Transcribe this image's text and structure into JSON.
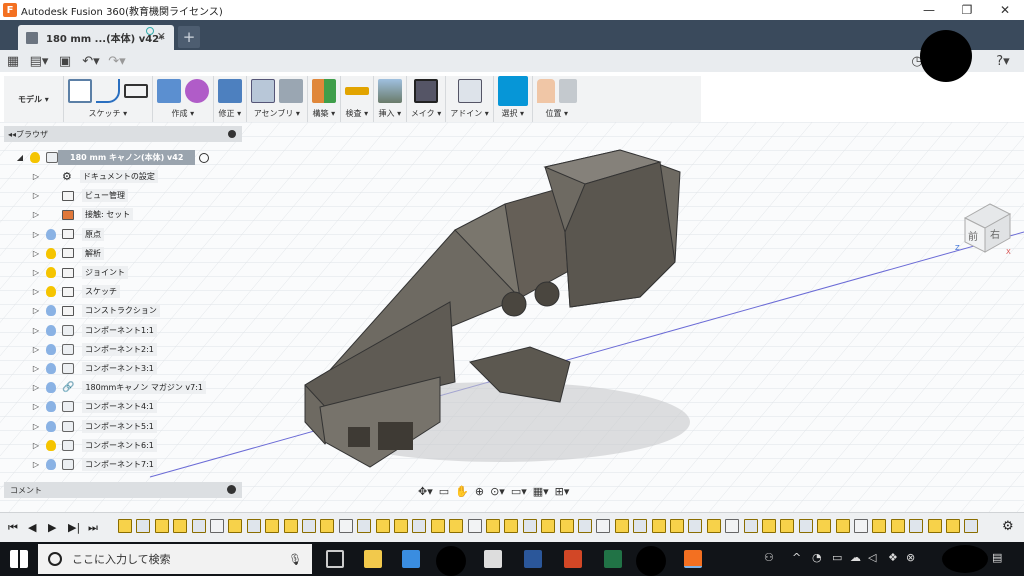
{
  "window": {
    "title": "Autodesk Fusion 360(教育機関ライセンス)",
    "logo": "F"
  },
  "tab": {
    "title": "180 mm ...(本体) v42*"
  },
  "toolbar": {
    "mode": "モデル ▾",
    "groups": [
      {
        "label": "スケッチ ▾",
        "icons": [
          "create-sketch",
          "line",
          "rectangle"
        ]
      },
      {
        "label": "作成 ▾",
        "icons": [
          "extrude",
          "form"
        ]
      },
      {
        "label": "修正 ▾",
        "icons": [
          "press-pull"
        ]
      },
      {
        "label": "アセンブリ ▾",
        "icons": [
          "new-component",
          "joint"
        ]
      },
      {
        "label": "構築 ▾",
        "icons": [
          "offset-plane"
        ]
      },
      {
        "label": "検査 ▾",
        "icons": [
          "measure"
        ]
      },
      {
        "label": "挿入 ▾",
        "icons": [
          "insert-image"
        ]
      },
      {
        "label": "メイク ▾",
        "icons": [
          "3d-print"
        ]
      },
      {
        "label": "アドイン ▾",
        "icons": [
          "scripts"
        ]
      },
      {
        "label": "選択 ▾",
        "icons": [
          "select"
        ]
      },
      {
        "label": "位置 ▾",
        "icons": [
          "position"
        ]
      }
    ]
  },
  "browser": {
    "title": "ブラウザ",
    "root": "180 mm キャノン(本体) v42",
    "items": [
      {
        "label": "ドキュメントの設定",
        "icon": "gear",
        "bulb": "none"
      },
      {
        "label": "ビュー管理",
        "icon": "folder",
        "bulb": "none"
      },
      {
        "label": "接触: セット",
        "icon": "contact",
        "bulb": "none"
      },
      {
        "label": "原点",
        "icon": "folder",
        "bulb": "off"
      },
      {
        "label": "解析",
        "icon": "folder",
        "bulb": "on"
      },
      {
        "label": "ジョイント",
        "icon": "folder",
        "bulb": "on"
      },
      {
        "label": "スケッチ",
        "icon": "folder",
        "bulb": "on"
      },
      {
        "label": "コンストラクション",
        "icon": "folder",
        "bulb": "off"
      },
      {
        "label": "コンポーネント1:1",
        "icon": "component",
        "bulb": "off"
      },
      {
        "label": "コンポーネント2:1",
        "icon": "component",
        "bulb": "off"
      },
      {
        "label": "コンポーネント3:1",
        "icon": "component",
        "bulb": "off"
      },
      {
        "label": "180mmキャノン マガジン v7:1",
        "icon": "link",
        "bulb": "off"
      },
      {
        "label": "コンポーネント4:1",
        "icon": "component",
        "bulb": "off"
      },
      {
        "label": "コンポーネント5:1",
        "icon": "component",
        "bulb": "off"
      },
      {
        "label": "コンポーネント6:1",
        "icon": "component",
        "bulb": "on"
      },
      {
        "label": "コンポーネント7:1",
        "icon": "component",
        "bulb": "off"
      }
    ]
  },
  "comment": {
    "label": "コメント"
  },
  "viewcube": {
    "front": "前",
    "right": "右",
    "axis_x": "X",
    "axis_z": "Z"
  },
  "taskbar": {
    "search_placeholder": "ここに入力して検索"
  },
  "colors": {
    "model": "#6e6a62",
    "accent": "#0696d7",
    "tabbar": "#3a4a5c"
  }
}
